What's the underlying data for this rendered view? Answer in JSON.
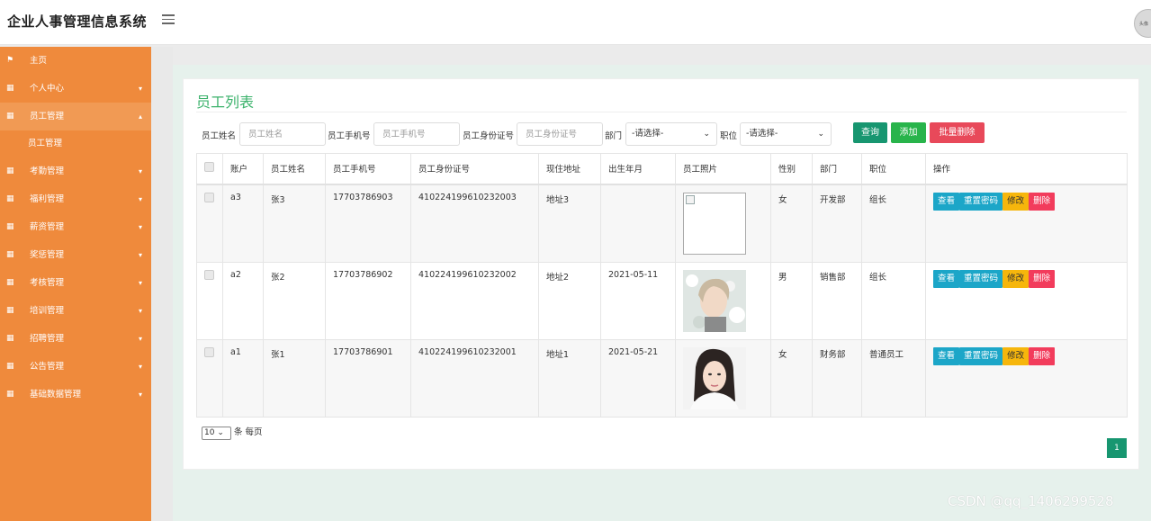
{
  "app": {
    "title": "企业人事管理信息系统"
  },
  "topbar": {
    "avatar_text": "头像"
  },
  "sidebar": {
    "items": [
      {
        "label": "主页",
        "icon": "flag-icon",
        "has_arrow": false
      },
      {
        "label": "个人中心",
        "icon": "grid-icon",
        "has_arrow": true,
        "arrow": "▾"
      },
      {
        "label": "员工管理",
        "icon": "grid-icon",
        "has_arrow": true,
        "arrow": "▴",
        "open": true,
        "sub": "员工管理"
      },
      {
        "label": "考勤管理",
        "icon": "grid-icon",
        "has_arrow": true,
        "arrow": "▾"
      },
      {
        "label": "福利管理",
        "icon": "grid-icon",
        "has_arrow": true,
        "arrow": "▾"
      },
      {
        "label": "薪资管理",
        "icon": "grid-icon",
        "has_arrow": true,
        "arrow": "▾"
      },
      {
        "label": "奖惩管理",
        "icon": "grid-icon",
        "has_arrow": true,
        "arrow": "▾"
      },
      {
        "label": "考核管理",
        "icon": "grid-icon",
        "has_arrow": true,
        "arrow": "▾"
      },
      {
        "label": "培训管理",
        "icon": "grid-icon",
        "has_arrow": true,
        "arrow": "▾"
      },
      {
        "label": "招聘管理",
        "icon": "grid-icon",
        "has_arrow": true,
        "arrow": "▾"
      },
      {
        "label": "公告管理",
        "icon": "grid-icon",
        "has_arrow": true,
        "arrow": "▾"
      },
      {
        "label": "基础数据管理",
        "icon": "grid-icon",
        "has_arrow": true,
        "arrow": "▾"
      }
    ]
  },
  "page": {
    "title": "员工列表"
  },
  "search": {
    "name_label": "员工姓名",
    "name_placeholder": "员工姓名",
    "phone_label": "员工手机号",
    "phone_placeholder": "员工手机号",
    "idcard_label": "员工身份证号",
    "idcard_placeholder": "员工身份证号",
    "dept_label": "部门",
    "dept_value": "-请选择-",
    "position_label": "职位",
    "position_value": "-请选择-",
    "query_label": "查询",
    "add_label": "添加",
    "batch_delete_label": "批量删除"
  },
  "table": {
    "headers": [
      "账户",
      "员工姓名",
      "员工手机号",
      "员工身份证号",
      "现住地址",
      "出生年月",
      "员工照片",
      "性别",
      "部门",
      "职位",
      "操作"
    ],
    "rows": [
      {
        "account": "a3",
        "name": "张3",
        "phone": "17703786903",
        "idcard": "410224199610232003",
        "address": "地址3",
        "birth": "",
        "photo": "broken",
        "gender": "女",
        "dept": "开发部",
        "position": "组长"
      },
      {
        "account": "a2",
        "name": "张2",
        "phone": "17703786902",
        "idcard": "410224199610232002",
        "address": "地址2",
        "birth": "2021-05-11",
        "photo": "portrait-flowers",
        "gender": "男",
        "dept": "销售部",
        "position": "组长"
      },
      {
        "account": "a1",
        "name": "张1",
        "phone": "17703786901",
        "idcard": "410224199610232001",
        "address": "地址1",
        "birth": "2021-05-21",
        "photo": "portrait-woman",
        "gender": "女",
        "dept": "财务部",
        "position": "普通员工"
      }
    ],
    "actions": {
      "view": "查看",
      "reset": "重置密码",
      "edit": "修改",
      "delete": "删除"
    }
  },
  "pagination": {
    "page_size": "10",
    "page_size_suffix": "条 每页",
    "current_page": "1"
  },
  "watermark": "CSDN @qq_1406299528",
  "colors": {
    "sidebar": "#ef8a3c",
    "accent_green": "#179670",
    "title_green": "#3bb26b",
    "danger": "#e8495a",
    "info": "#1ca6c8",
    "warning": "#f6b60c"
  }
}
